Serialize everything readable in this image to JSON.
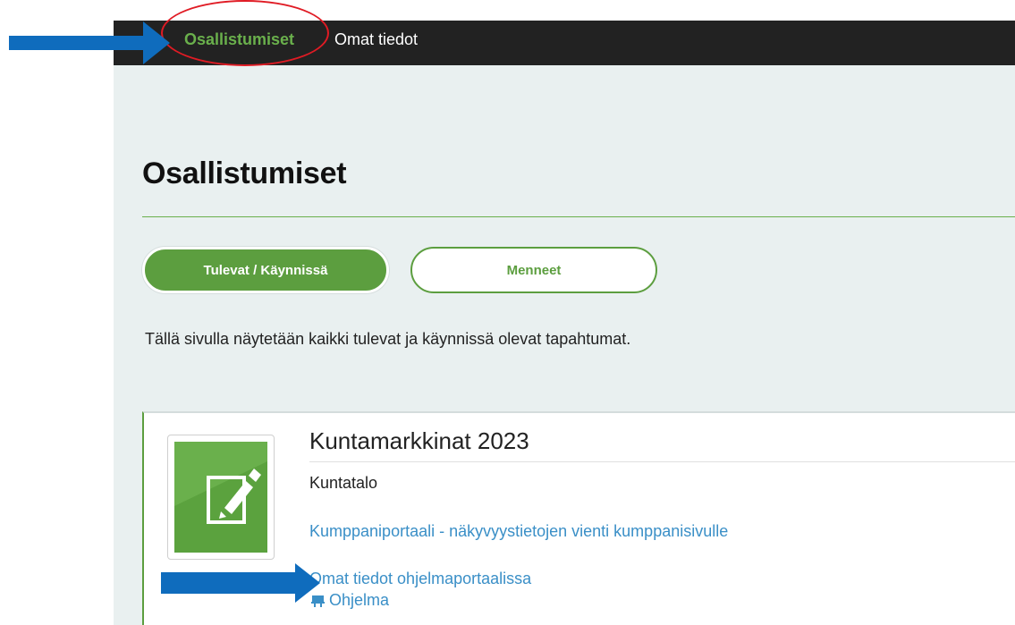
{
  "topbar": {
    "nav": [
      {
        "label": "Osallistumiset",
        "active": true
      },
      {
        "label": "Omat tiedot",
        "active": false
      }
    ]
  },
  "page": {
    "title": "Osallistumiset",
    "tabs": [
      {
        "label": "Tulevat / Käynnissä",
        "selected": true
      },
      {
        "label": "Menneet",
        "selected": false
      }
    ],
    "intro": "Tällä sivulla näytetään kaikki tulevat ja käynnissä olevat tapahtumat."
  },
  "event": {
    "title": "Kuntamarkkinat 2023",
    "venue": "Kuntatalo",
    "portal_link": "Kumppaniportaali - näkyvyystietojen vienti kumppanisivulle",
    "own_info_link": "Omat tiedot ohjelmaportaalissa",
    "program_link": "Ohjelma",
    "program_icon": "presentation-board-icon",
    "thumbnail_icon": "edit-document-icon"
  },
  "annotations": {
    "arrow_color": "#0f6cbd",
    "ellipse_color": "#e01b24"
  },
  "colors": {
    "accent": "#5c9e3f",
    "link": "#3a8fc7",
    "topbar": "#222222",
    "background": "#e9f0f0"
  }
}
